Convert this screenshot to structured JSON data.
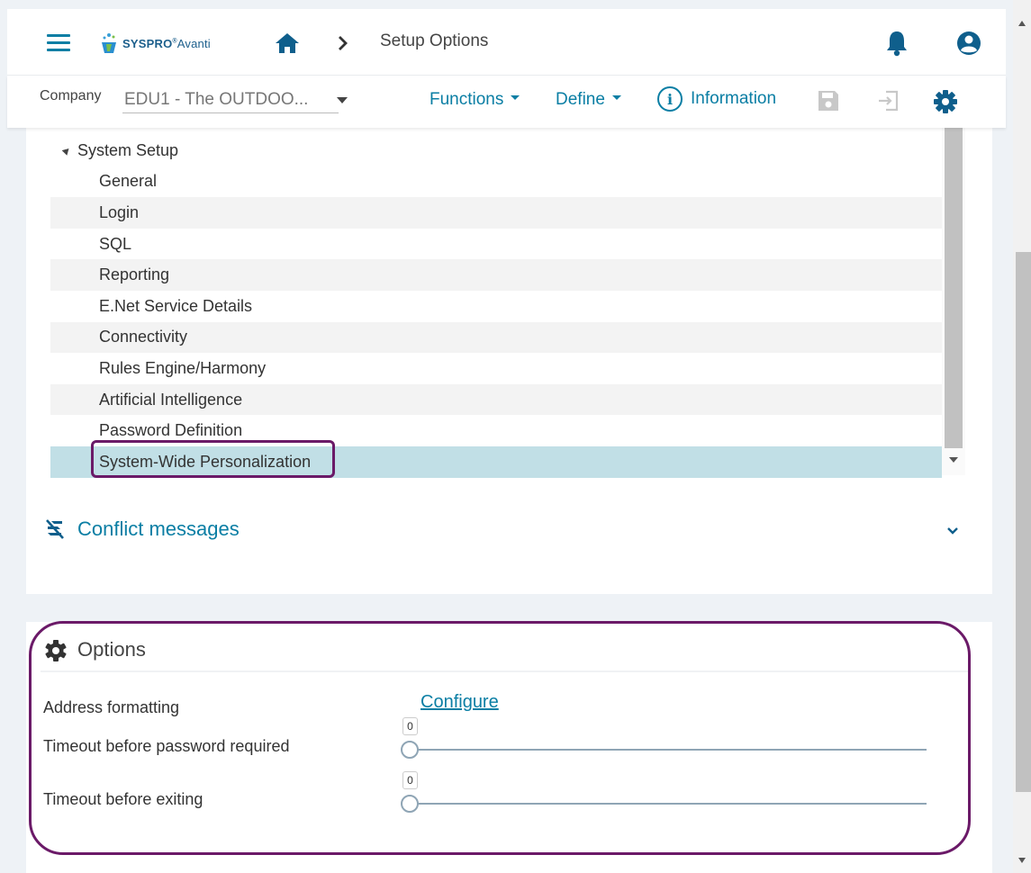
{
  "header": {
    "logo_text": "SYSPRO",
    "logo_sub": "Avanti",
    "page_title": "Setup Options",
    "icons": [
      "hamburger-menu-icon",
      "home-icon",
      "chevron-right-icon",
      "bell-icon",
      "user-account-icon"
    ]
  },
  "toolbar": {
    "company_label": "Company",
    "company_value": "EDU1 - The OUTDOO...",
    "functions_label": "Functions",
    "define_label": "Define",
    "information_label": "Information",
    "icons": [
      "info-icon",
      "save-icon",
      "exit-icon",
      "settings-icon"
    ]
  },
  "tree": {
    "parent": "System Setup",
    "items": [
      {
        "label": "General"
      },
      {
        "label": "Login"
      },
      {
        "label": "SQL"
      },
      {
        "label": "Reporting"
      },
      {
        "label": "E.Net Service Details"
      },
      {
        "label": "Connectivity"
      },
      {
        "label": "Rules Engine/Harmony"
      },
      {
        "label": "Artificial Intelligence"
      },
      {
        "label": "Password Definition"
      },
      {
        "label": "System-Wide Personalization",
        "selected": true
      }
    ]
  },
  "conflict": {
    "label": "Conflict messages"
  },
  "options": {
    "title": "Options",
    "address_label": "Address formatting",
    "configure_label": "Configure",
    "timeout_password_label": "Timeout before password required",
    "timeout_password_value": "0",
    "timeout_exit_label": "Timeout before exiting",
    "timeout_exit_value": "0"
  },
  "colors": {
    "accent": "#0a7ea4",
    "selected_row": "#c1dfe6",
    "highlight": "#6b1a68"
  }
}
